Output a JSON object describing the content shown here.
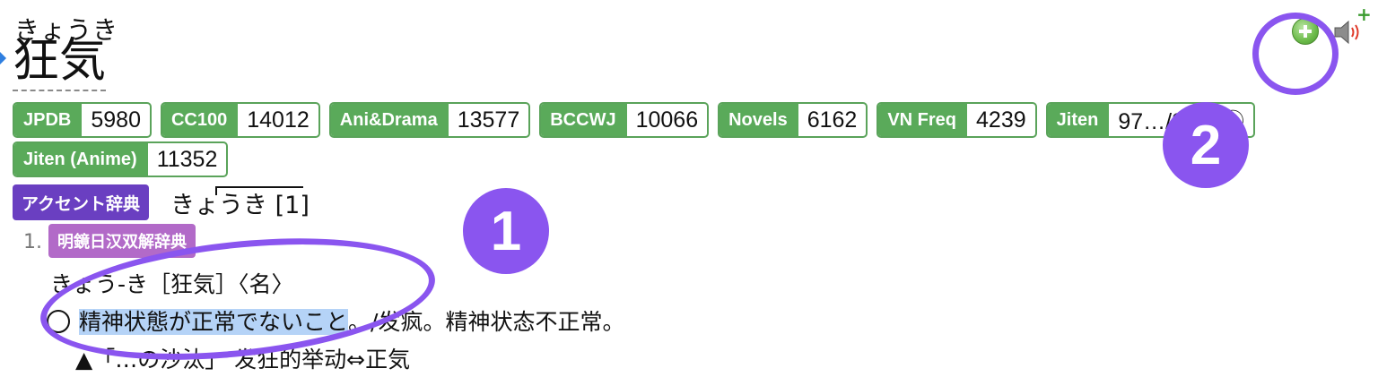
{
  "entry": {
    "reading": "きょうき",
    "headword": "狂気"
  },
  "frequency_tags": [
    {
      "name": "JPDB",
      "value": "5980"
    },
    {
      "name": "CC100",
      "value": "14012"
    },
    {
      "name": "Ani&Drama",
      "value": "13577"
    },
    {
      "name": "BCCWJ",
      "value": "10066"
    },
    {
      "name": "Novels",
      "value": "6162"
    },
    {
      "name": "VN Freq",
      "value": "4239"
    },
    {
      "name": "Jiten",
      "value": "97…/8593㋕"
    },
    {
      "name": "Jiten (Anime)",
      "value": "11352"
    }
  ],
  "accent": {
    "label": "アクセント辞典",
    "reading": "きょうき [1]"
  },
  "definition": {
    "number": "1.",
    "dictionary": "明鏡日汉双解辞典",
    "heading": "きょう-き［狂気］〈名〉",
    "meaning_highlight": "精神状態が正常でないこと",
    "meaning_rest": "。/发疯。精神状态不正常。",
    "example": "▲「…の沙汰」 发狂的举动⇔正気"
  },
  "annotations": {
    "badge_1": "1",
    "badge_2": "2"
  },
  "icons": {
    "add": "add-note-icon",
    "audio": "speaker-icon"
  },
  "colors": {
    "freq_green": "#5aaa5a",
    "accent_purple": "#6a3fc1",
    "dict_purple": "#b26ac8",
    "highlight": "#b5d3f7",
    "annotation": "#8a55ef"
  }
}
